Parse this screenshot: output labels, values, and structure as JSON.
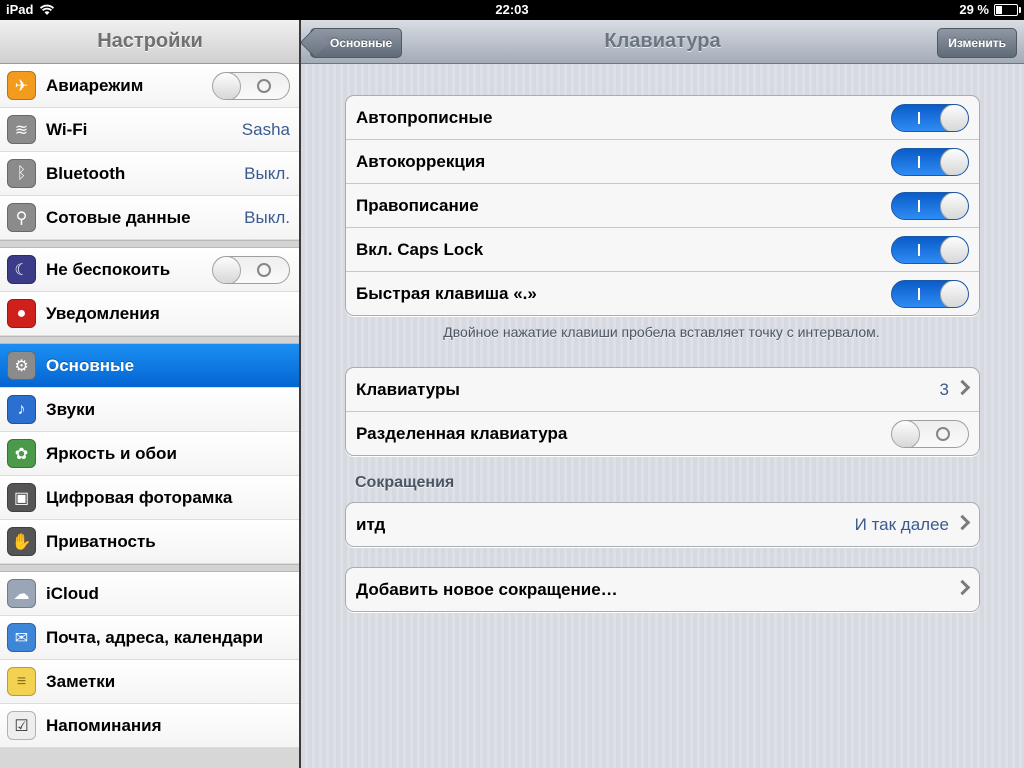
{
  "status": {
    "device": "iPad",
    "time": "22:03",
    "battery": "29 %",
    "battery_level": 0.29
  },
  "sidebar": {
    "title": "Настройки",
    "groups": [
      [
        {
          "label": "Авиарежим",
          "icon": "airplane-icon",
          "icon_color": "#f29b1d",
          "toggle": "off"
        },
        {
          "label": "Wi-Fi",
          "icon": "wifi-icon",
          "icon_color": "#8b8b8b",
          "value": "Sasha"
        },
        {
          "label": "Bluetooth",
          "icon": "bluetooth-icon",
          "icon_color": "#8b8b8b",
          "value": "Выкл."
        },
        {
          "label": "Сотовые данные",
          "icon": "cellular-icon",
          "icon_color": "#8b8b8b",
          "value": "Выкл."
        }
      ],
      [
        {
          "label": "Не беспокоить",
          "icon": "moon-icon",
          "icon_color": "#3b3b8a",
          "toggle": "off"
        },
        {
          "label": "Уведомления",
          "icon": "notifications-icon",
          "icon_color": "#d0201b"
        }
      ],
      [
        {
          "label": "Основные",
          "icon": "gear-icon",
          "icon_color": "#8b8b8b",
          "selected": true
        },
        {
          "label": "Звуки",
          "icon": "speaker-icon",
          "icon_color": "#2b6fd0"
        },
        {
          "label": "Яркость и обои",
          "icon": "flower-icon",
          "icon_color": "#4a9a4a"
        },
        {
          "label": "Цифровая фоторамка",
          "icon": "photo-frame-icon",
          "icon_color": "#555555"
        },
        {
          "label": "Приватность",
          "icon": "hand-icon",
          "icon_color": "#555555"
        }
      ],
      [
        {
          "label": "iCloud",
          "icon": "cloud-icon",
          "icon_color": "#9aa5b5"
        },
        {
          "label": "Почта, адреса, календари",
          "icon": "mail-icon",
          "icon_color": "#3d86d8"
        },
        {
          "label": "Заметки",
          "icon": "notes-icon",
          "icon_color": "#f3d252"
        },
        {
          "label": "Напоминания",
          "icon": "reminders-icon",
          "icon_color": "#eeeeee"
        }
      ]
    ]
  },
  "navbar": {
    "back": "Основные",
    "title": "Клавиатура",
    "edit": "Изменить"
  },
  "keyboard": {
    "toggles": [
      {
        "label": "Автопрописные",
        "on": true
      },
      {
        "label": "Автокоррекция",
        "on": true
      },
      {
        "label": "Правописание",
        "on": true
      },
      {
        "label": "Вкл. Caps Lock",
        "on": true
      },
      {
        "label": "Быстрая клавиша «.»",
        "on": true
      }
    ],
    "footnote": "Двойное нажатие клавиши пробела вставляет точку с интервалом.",
    "keyboards_label": "Клавиатуры",
    "keyboards_count": "3",
    "split_label": "Разделенная клавиатура",
    "split_on": false,
    "shortcuts_header": "Сокращения",
    "shortcut_label": "итд",
    "shortcut_value": "И так далее",
    "add_shortcut": "Добавить новое сокращение…"
  }
}
